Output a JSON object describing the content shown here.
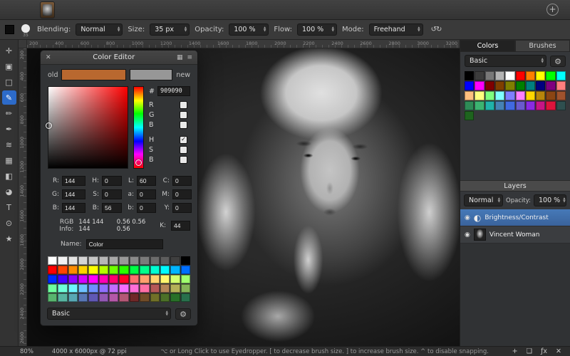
{
  "titlebar": {
    "plus": "+"
  },
  "icons": {
    "close": "✕",
    "grid": "▦",
    "menu": "≡",
    "gear": "⚙",
    "stepper_up": "▲",
    "stepper_down": "▼",
    "eye": "◉",
    "adjustment": "◐",
    "check": "✓",
    "smoothing": "↺↻",
    "status_add": "+",
    "status_folder": "❏",
    "status_fx": "ƒx",
    "status_trash": "✕"
  },
  "toolbar": {
    "brush_size_preview": "35",
    "blending_label": "Blending:",
    "blending_value": "Normal",
    "size_label": "Size:",
    "size_value": "35 px",
    "opacity_label": "Opacity:",
    "opacity_value": "100 %",
    "flow_label": "Flow:",
    "flow_value": "100 %",
    "mode_label": "Mode:",
    "mode_value": "Freehand"
  },
  "tools": [
    {
      "name": "move-tool",
      "glyph": "✛",
      "selected": false
    },
    {
      "name": "crop-tool",
      "glyph": "▣",
      "selected": false
    },
    {
      "name": "marquee-tool",
      "glyph": "□",
      "selected": false
    },
    {
      "name": "brush-tool",
      "glyph": "✎",
      "selected": true
    },
    {
      "name": "pencil-tool",
      "glyph": "✏",
      "selected": false
    },
    {
      "name": "ink-pen-tool",
      "glyph": "✒",
      "selected": false
    },
    {
      "name": "smudge-tool",
      "glyph": "≋",
      "selected": false
    },
    {
      "name": "clone-stamp-tool",
      "glyph": "▦",
      "selected": false
    },
    {
      "name": "gradient-tool",
      "glyph": "◧",
      "selected": false
    },
    {
      "name": "fill-bucket-tool",
      "glyph": "◕",
      "selected": false
    },
    {
      "name": "text-tool",
      "glyph": "T",
      "selected": false
    },
    {
      "name": "zoom-tool",
      "glyph": "⊙",
      "selected": false
    },
    {
      "name": "favorites-star-tool",
      "glyph": "★",
      "selected": false
    }
  ],
  "rulers": {
    "top": [
      "200",
      "400",
      "600",
      "800",
      "1000",
      "1200",
      "1400",
      "1600",
      "1800",
      "2000",
      "2200",
      "2400",
      "2600",
      "2800",
      "3000",
      "3200"
    ],
    "left": [
      "200",
      "400",
      "600",
      "800",
      "1000",
      "1200",
      "1400",
      "1600",
      "1800",
      "2000",
      "2200",
      "2400",
      "2600"
    ]
  },
  "color_editor": {
    "title": "Color Editor",
    "old_label": "old",
    "new_label": "new",
    "old_color": "#b9682f",
    "new_color": "#979797",
    "hex_label": "#",
    "hex_value": "909090",
    "channels": [
      {
        "label": "R",
        "checked": false
      },
      {
        "label": "G",
        "checked": false
      },
      {
        "label": "B",
        "checked": false
      },
      {
        "label": "H",
        "checked": true
      },
      {
        "label": "S",
        "checked": false
      },
      {
        "label": "B",
        "checked": false
      }
    ],
    "fields": {
      "r_label": "R:",
      "r": "144",
      "h_label": "H:",
      "h": "0",
      "l_label": "L:",
      "l": "60",
      "c_label": "C:",
      "c": "0",
      "g_label": "G:",
      "g": "144",
      "s_label": "S:",
      "s": "0",
      "a_label": "a:",
      "a": "0",
      "m_label": "M:",
      "m": "0",
      "b_label": "B:",
      "b": "144",
      "b2_label": "B:",
      "b2": "56",
      "bb_label": "b:",
      "bb": "0",
      "y_label": "Y:",
      "y": "0",
      "info_label": "RGB Info:",
      "info_rgb": "144 144 144",
      "info_float": "0.56 0.56 0.56",
      "k_label": "K:",
      "k": "44"
    },
    "name_label": "Name:",
    "name_value": "Color",
    "preset_value": "Basic",
    "swatches": [
      "#ffffff",
      "#f2f2f2",
      "#e3e3e3",
      "#d5d5d5",
      "#c6c6c6",
      "#b7b7b7",
      "#a8a8a8",
      "#999999",
      "#8a8a8a",
      "#7b7b7b",
      "#6c6c6c",
      "#5d5d5d",
      "#3f3f3f",
      "#000000",
      "#ff0000",
      "#ff4600",
      "#ff8c00",
      "#ffd300",
      "#fbff00",
      "#b4ff00",
      "#6eff00",
      "#28ff00",
      "#00ff46",
      "#00ff8c",
      "#00ffd3",
      "#00fbff",
      "#00b4ff",
      "#006eff",
      "#0028ff",
      "#4600ff",
      "#8c00ff",
      "#d300ff",
      "#ff00fb",
      "#ff00b4",
      "#ff006e",
      "#ff0028",
      "#ff6e6e",
      "#ffa06e",
      "#ffd26e",
      "#fff66e",
      "#d2ff6e",
      "#a0ff6e",
      "#6eff9e",
      "#6effd8",
      "#6ef4ff",
      "#6ec2ff",
      "#6e90ff",
      "#906eff",
      "#c26eff",
      "#f46eff",
      "#ff6ed8",
      "#ff6ea6",
      "#b45858",
      "#b48558",
      "#b4b158",
      "#85b458",
      "#58b46e",
      "#58b4a0",
      "#58a8b4",
      "#5876b4",
      "#6058b4",
      "#9258b4",
      "#b458a8",
      "#b45876",
      "#702828",
      "#704c28",
      "#707028",
      "#4c7028",
      "#287028",
      "#28704c"
    ]
  },
  "right_panel": {
    "tabs": [
      {
        "label": "Colors",
        "active": true
      },
      {
        "label": "Brushes",
        "active": false
      }
    ],
    "preset_value": "Basic",
    "swatches": [
      "#000000",
      "#3c3c3c",
      "#787878",
      "#b4b4b4",
      "#ffffff",
      "#ff0000",
      "#ff7f00",
      "#ffff00",
      "#00ff00",
      "#00ffff",
      "#0000ff",
      "#ff00ff",
      "#7f0000",
      "#7f3f00",
      "#7f7f00",
      "#007f00",
      "#007f7f",
      "#00007f",
      "#7f007f",
      "#ff7f7f",
      "#ffbf7f",
      "#ffff7f",
      "#7fff7f",
      "#7fffff",
      "#7f7fff",
      "#ff7fff",
      "#ffd700",
      "#b8860b",
      "#8b4513",
      "#a0522d",
      "#2e8b57",
      "#3cb371",
      "#20b2aa",
      "#4682b4",
      "#4169e1",
      "#6a5acd",
      "#8a2be2",
      "#c71585",
      "#dc143c",
      "#2f4f4f",
      "#1e641e"
    ],
    "layers": {
      "header": "Layers",
      "blend_value": "Normal",
      "opacity_label": "Opacity:",
      "opacity_value": "100 %",
      "items": [
        {
          "name": "Brightness/Contrast",
          "selected": true
        },
        {
          "name": "Vincent Woman",
          "selected": false
        }
      ]
    }
  },
  "statusbar": {
    "zoom": "80%",
    "doc_info": "4000 x 6000px @ 72 ppi",
    "hint": "⌥ or Long Click to use Eyedropper.  [ to decrease brush size.  ] to increase brush size.  ^ to disable snapping."
  }
}
